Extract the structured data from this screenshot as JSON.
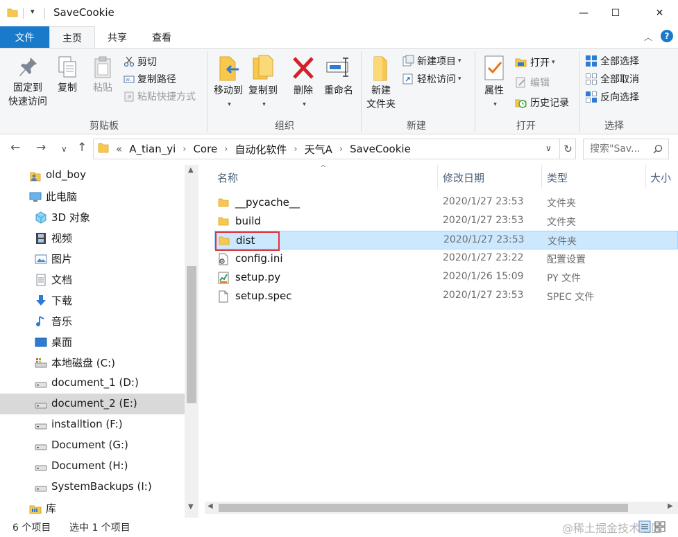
{
  "window": {
    "title": "SaveCookie",
    "minimize_symbol": "—",
    "maximize_symbol": "☐",
    "close_symbol": "✕",
    "quick_access_dropdown": "▾"
  },
  "ribbon_tabs": {
    "file": "文件",
    "home": "主页",
    "share": "共享",
    "view": "查看",
    "collapse_symbol": "︿",
    "help_symbol": "?"
  },
  "ribbon": {
    "clipboard": {
      "pin_line1": "固定到",
      "pin_line2": "快速访问",
      "copy": "复制",
      "paste": "粘贴",
      "cut": "剪切",
      "copy_path": "复制路径",
      "paste_shortcut": "粘贴快捷方式",
      "group_label": "剪贴板"
    },
    "organize": {
      "move_to": "移动到",
      "copy_to": "复制到",
      "delete": "删除",
      "rename": "重命名",
      "group_label": "组织"
    },
    "new": {
      "new_folder_line1": "新建",
      "new_folder_line2": "文件夹",
      "new_item": "新建项目",
      "easy_access": "轻松访问",
      "group_label": "新建"
    },
    "open": {
      "properties": "属性",
      "open": "打开",
      "edit": "编辑",
      "history": "历史记录",
      "group_label": "打开"
    },
    "select": {
      "select_all": "全部选择",
      "select_none": "全部取消",
      "invert": "反向选择",
      "group_label": "选择"
    }
  },
  "address": {
    "back": "←",
    "forward": "→",
    "recent": "∨",
    "up": "↑",
    "overflow": "«",
    "breadcrumbs": [
      "A_tian_yi",
      "Core",
      "自动化软件",
      "天气A",
      "SaveCookie"
    ],
    "separator": "›",
    "dropdown": "∨",
    "refresh": "↻"
  },
  "search": {
    "placeholder": "搜索\"Sav..."
  },
  "nav": {
    "items": [
      {
        "label": "old_boy",
        "icon": "user-folder-icon"
      },
      {
        "label": "此电脑",
        "icon": "computer-icon"
      },
      {
        "label": "3D 对象",
        "icon": "3d-objects-icon"
      },
      {
        "label": "视频",
        "icon": "video-icon"
      },
      {
        "label": "图片",
        "icon": "pictures-icon"
      },
      {
        "label": "文档",
        "icon": "documents-icon"
      },
      {
        "label": "下载",
        "icon": "download-icon"
      },
      {
        "label": "音乐",
        "icon": "music-icon"
      },
      {
        "label": "桌面",
        "icon": "desktop-icon"
      },
      {
        "label": "本地磁盘 (C:)",
        "icon": "system-drive-icon"
      },
      {
        "label": "document_1 (D:)",
        "icon": "drive-icon"
      },
      {
        "label": "document_2 (E:)",
        "icon": "drive-icon"
      },
      {
        "label": "installtion (F:)",
        "icon": "drive-icon"
      },
      {
        "label": "Document (G:)",
        "icon": "drive-icon"
      },
      {
        "label": "Document (H:)",
        "icon": "drive-icon"
      },
      {
        "label": "SystemBackups (I:)",
        "icon": "drive-icon"
      },
      {
        "label": "库",
        "icon": "library-icon"
      }
    ],
    "selected_index": 11
  },
  "filelist": {
    "columns": {
      "name": "名称",
      "date": "修改日期",
      "type": "类型",
      "size": "大小",
      "sort_indicator": "^"
    },
    "rows": [
      {
        "name": "__pycache__",
        "date": "2020/1/27 23:53",
        "type": "文件夹",
        "icon": "folder-icon"
      },
      {
        "name": "build",
        "date": "2020/1/27 23:53",
        "type": "文件夹",
        "icon": "folder-icon"
      },
      {
        "name": "dist",
        "date": "2020/1/27 23:53",
        "type": "文件夹",
        "icon": "folder-icon"
      },
      {
        "name": "config.ini",
        "date": "2020/1/27 23:22",
        "type": "配置设置",
        "icon": "settings-file-icon"
      },
      {
        "name": "setup.py",
        "date": "2020/1/26 15:09",
        "type": "PY 文件",
        "icon": "python-file-icon"
      },
      {
        "name": "setup.spec",
        "date": "2020/1/27 23:53",
        "type": "SPEC 文件",
        "icon": "blank-file-icon"
      }
    ],
    "selected_index": 2
  },
  "status": {
    "item_count": "6 个项目",
    "selected": "选中 1 个项目",
    "watermark": "@稀土掘金技术社区"
  },
  "colors": {
    "accent": "#1979ca",
    "selection": "#cce8ff",
    "highlight_box": "#e0323c",
    "folder": "#f8c74e"
  }
}
